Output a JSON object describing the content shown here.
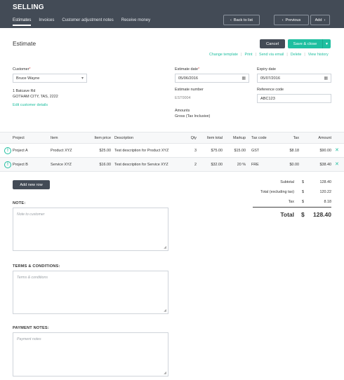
{
  "app": {
    "title": "SELLING"
  },
  "subnav": [
    "Estimates",
    "Invoices",
    "Customer adjustment notes",
    "Receive money"
  ],
  "toolbar": {
    "back": "Back to list",
    "previous": "Previous",
    "add": "Add"
  },
  "page": {
    "title": "Estimate"
  },
  "buttons": {
    "cancel": "Cancel",
    "save_close": "Save & close",
    "add_new_row": "Add new row"
  },
  "actions": [
    "Change template",
    "Print",
    "Send via email",
    "Delete",
    "View history"
  ],
  "customer": {
    "label": "Customer",
    "required": "*",
    "value": "Bruce Wayne",
    "address_line1": "1 Batcave Rd",
    "address_line2": "GOTHAM CITY, TAS, 2222",
    "edit_link": "Edit customer details"
  },
  "estimate_date": {
    "label": "Estimate date",
    "required": "*",
    "value": "05/06/2016"
  },
  "expiry_date": {
    "label": "Expiry date",
    "value": "05/07/2016"
  },
  "estimate_number": {
    "label": "Estimate number",
    "value": "EST0004"
  },
  "reference_code": {
    "label": "Reference code",
    "value": "ABC123"
  },
  "amounts": {
    "label": "Amounts",
    "value": "Gross (Tax Inclusive)"
  },
  "table": {
    "headers": [
      "Project",
      "Item",
      "Item price",
      "Description",
      "Qty",
      "Item total",
      "Markup",
      "Tax code",
      "Tax",
      "Amount"
    ],
    "rows": [
      [
        "Project A",
        "Product XYZ",
        "$25.00",
        "Test description for Product XYZ",
        "3",
        "$75.00",
        "$15.00",
        "GST",
        "$8.18",
        "$90.00"
      ],
      [
        "Project B",
        "Service XYZ",
        "$16.00",
        "Test description for Service XYZ",
        "2",
        "$32.00",
        "20 %",
        "FRE",
        "$0.00",
        "$38.40"
      ]
    ]
  },
  "totals": {
    "currency": "$",
    "subtotal_label": "Subtotal",
    "subtotal": "128.40",
    "excl_label": "Total (excluding tax)",
    "excl": "120.22",
    "tax_label": "Tax",
    "tax": "8.18",
    "total_label": "Total",
    "total": "128.40"
  },
  "note": {
    "title": "NOTE:",
    "placeholder": "Note to customer"
  },
  "terms": {
    "title": "TERMS & CONDITIONS:",
    "placeholder": "Terms & conditions"
  },
  "payment": {
    "title": "PAYMENT NOTES:",
    "placeholder": "Payment notes"
  },
  "colors": {
    "topbar": "#434b56",
    "accent": "#1fbfa0",
    "dark_button": "#434b56"
  }
}
